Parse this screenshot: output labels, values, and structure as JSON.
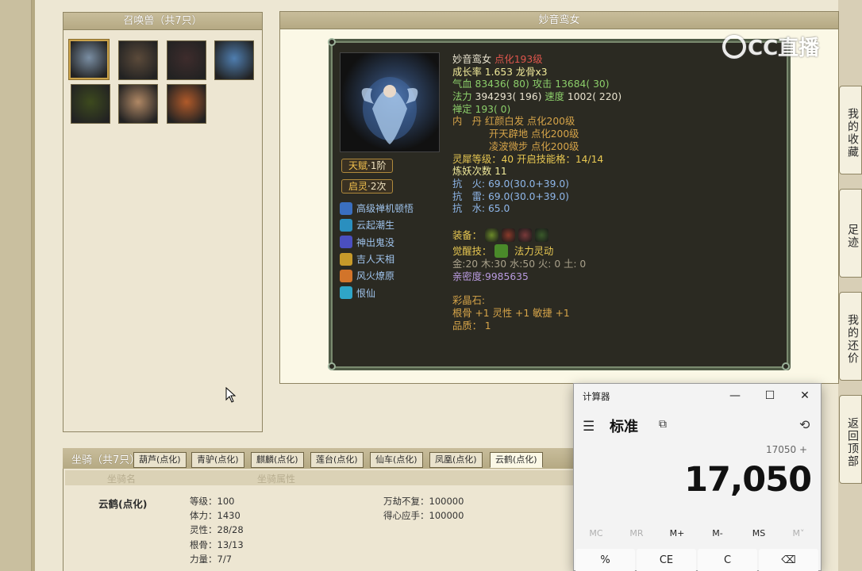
{
  "pets": {
    "title": "召唤兽（共7只）",
    "items": [
      {
        "name": "pet-1",
        "color": "#7a8ea3"
      },
      {
        "name": "pet-2",
        "color": "#5b4a3a"
      },
      {
        "name": "pet-3",
        "color": "#3e2c2c"
      },
      {
        "name": "pet-4",
        "color": "#4f7eb0"
      },
      {
        "name": "pet-5",
        "color": "#3d4a1e"
      },
      {
        "name": "pet-6",
        "color": "#b08865"
      },
      {
        "name": "pet-7",
        "color": "#b05a2a"
      }
    ]
  },
  "detail": {
    "header": "妙音鸾女",
    "talent_tag": {
      "label": "天赋",
      "value": "·1阶"
    },
    "qiling_tag": {
      "label": "启灵",
      "value": "·2次"
    },
    "skills": [
      {
        "label": "高级禅机顿悟",
        "color": "#3a6fbf"
      },
      {
        "label": "云起潮生",
        "color": "#2a8fbf"
      },
      {
        "label": "神出鬼没",
        "color": "#4a4fbf"
      },
      {
        "label": "吉人天相",
        "color": "#c79a2a"
      },
      {
        "label": "风火燎原",
        "color": "#d2742a"
      },
      {
        "label": "恨仙",
        "color": "#2fa5c7"
      }
    ],
    "name": "妙音鸾女",
    "dianhua": "点化193级",
    "growth_label": "成长率 1.653 龙骨x3",
    "hp_label": "气血",
    "hp_value": "83436( 80)",
    "atk_label": "攻击",
    "atk_value": "13684( 30)",
    "mp_label": "法力",
    "mp_value": "394293( 196)",
    "spd_label": "速度",
    "spd_value": "1002( 220)",
    "chanding": "禅定 193( 0)",
    "neidan_label": "内　丹",
    "neidan": [
      "红颜白发 点化200级",
      "开天辟地 点化200级",
      "凌波微步 点化200级"
    ],
    "lingxi": "灵犀等级：40 开启技能格：14/14",
    "lianyao": "炼妖次数 11",
    "resist_fire": "抗　火: 69.0(30.0+39.0)",
    "resist_thunder": "抗　雷: 69.0(30.0+39.0)",
    "resist_water": "抗　水: 65.0",
    "equip_label": "装备：",
    "equips": [
      {
        "name": "equip-1",
        "color": "#6b8a2a"
      },
      {
        "name": "equip-2",
        "color": "#8a3a2a"
      },
      {
        "name": "equip-3",
        "color": "#7a3a3a"
      },
      {
        "name": "equip-4",
        "color": "#3a5a2a"
      }
    ],
    "awaken_label": "觉醒技：",
    "awaken_skill": "法力灵动",
    "elements": "金:20 木:30 水:50 火: 0 土: 0",
    "intimacy": "亲密度:9985635",
    "gem_label": "彩晶石:",
    "gem_attr": "根骨 +1 灵性 +1 敏捷 +1",
    "quality": "品质： 1"
  },
  "watermark": "CC直播",
  "side_tabs": [
    "我的收藏",
    "足迹",
    "我的还价",
    "返回顶部"
  ],
  "mounts": {
    "title": "坐骑（共7只）",
    "tabs": [
      "葫芦(点化)",
      "青驴(点化)",
      "麒麟(点化)",
      "莲台(点化)",
      "仙车(点化)",
      "凤凰(点化)",
      "云鹤(点化)"
    ],
    "active_tab": 6,
    "col_name": "坐骑名",
    "col_attr": "坐骑属性",
    "name": "云鹤(点化)",
    "attrs": [
      "等级：100",
      "体力：1430",
      "灵性：28/28",
      "根骨：13/13",
      "力量：7/7"
    ],
    "extras": [
      "万劫不复：100000",
      "得心应手：100000"
    ]
  },
  "calculator": {
    "title": "计算器",
    "minimize": "—",
    "maximize": "☐",
    "close": "✕",
    "mode": "标准",
    "expression": "17050 +",
    "display": "17,050",
    "memory": [
      "MC",
      "MR",
      "M+",
      "M-",
      "MS",
      "M˅"
    ],
    "keys": [
      "%",
      "CE",
      "C",
      "⌫"
    ]
  }
}
